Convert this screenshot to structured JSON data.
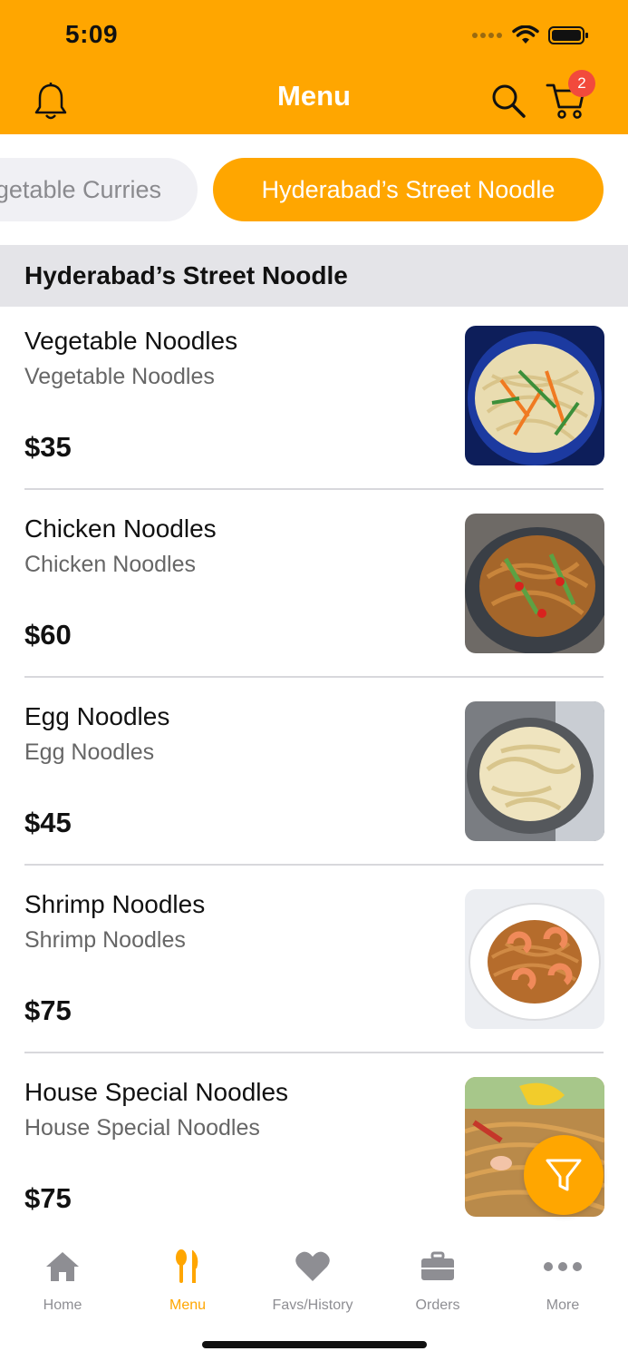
{
  "status_bar": {
    "time": "5:09"
  },
  "header": {
    "title": "Menu",
    "icons": [
      "bell-icon",
      "search-icon",
      "cart-icon"
    ],
    "cart_badge": "2"
  },
  "categories": [
    {
      "label": "Vegetable Curries",
      "active": false
    },
    {
      "label": "Hyderabad’s Street Noodle",
      "active": true
    }
  ],
  "section": {
    "title": "Hyderabad’s Street Noodle"
  },
  "items": [
    {
      "name": "Vegetable Noodles",
      "description": "Vegetable Noodles",
      "price": "$35"
    },
    {
      "name": "Chicken Noodles",
      "description": "Chicken Noodles",
      "price": "$60"
    },
    {
      "name": "Egg Noodles",
      "description": "Egg Noodles",
      "price": "$45"
    },
    {
      "name": "Shrimp Noodles",
      "description": "Shrimp Noodles",
      "price": "$75"
    },
    {
      "name": "House Special Noodles",
      "description": "House Special Noodles",
      "price": "$75"
    }
  ],
  "fab": {
    "icon": "filter-icon"
  },
  "tabbar": {
    "tabs": [
      {
        "label": "Home",
        "icon": "home-icon",
        "active": false
      },
      {
        "label": "Menu",
        "icon": "utensils-icon",
        "active": true
      },
      {
        "label": "Favs/History",
        "icon": "heart-icon",
        "active": false
      },
      {
        "label": "Orders",
        "icon": "briefcase-icon",
        "active": false
      },
      {
        "label": "More",
        "icon": "more-icon",
        "active": false
      }
    ]
  },
  "colors": {
    "accent": "#FFA600",
    "badge": "#F24A3C",
    "inactive": "#8E8E93",
    "section_bg": "#E4E4E8"
  }
}
